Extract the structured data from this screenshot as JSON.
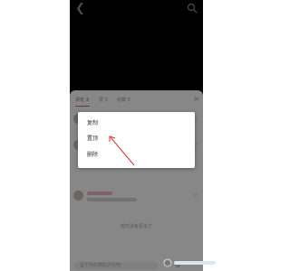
{
  "header": {
    "back_icon": "chevron-left-icon",
    "search_icon": "search-icon"
  },
  "tabs": [
    {
      "label": "评论 3",
      "active": true
    },
    {
      "label": "赞 5",
      "active": false
    },
    {
      "label": "收藏 0",
      "active": false
    }
  ],
  "context_menu": {
    "items": [
      {
        "label": "复制"
      },
      {
        "label": "置顶"
      },
      {
        "label": "删除"
      }
    ]
  },
  "comments_footer": "暂时没有更多了",
  "input": {
    "placeholder": "留下你的精彩评论吧"
  },
  "icons": {
    "emoji": "emoji-icon",
    "mention": "at-icon",
    "heart": "heart-icon"
  },
  "colors": {
    "accent": "#d65b78",
    "annotation_arrow": "#d9362f"
  }
}
